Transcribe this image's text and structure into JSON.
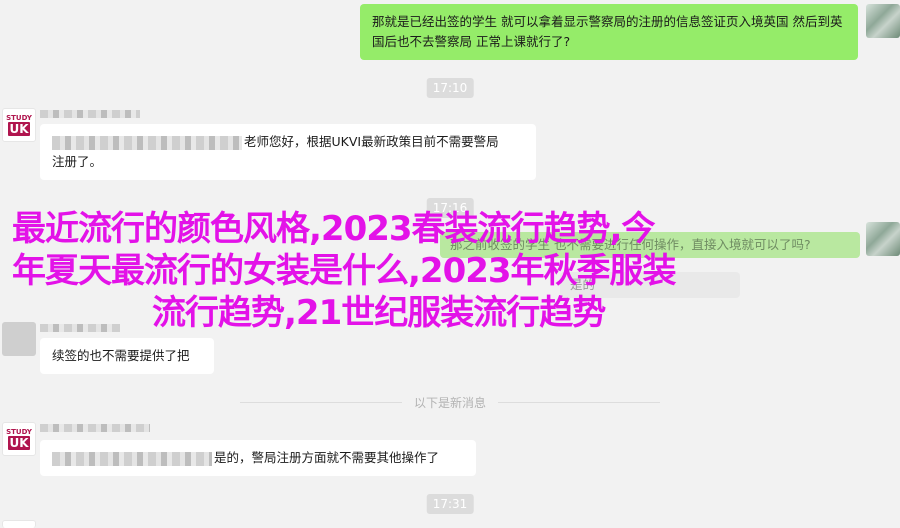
{
  "messages": {
    "m1": "那就是已经出签的学生 就可以拿着显示警察局的注册的信息签证页入境英国 然后到英国后也不去警察局 正常上课就行了?",
    "t1": "17:10",
    "m2_suffix": "老师您好，根据UKVI最新政策目前不需要警局",
    "m2_line2": "注册了。",
    "t2": "17:16",
    "m3_faint": "那之前收签的学生 也不需要进行任何操作，直接入境就可以了吗?",
    "m4_faint": "是的",
    "m5": "续签的也不需要提供了把",
    "divider": "以下是新消息",
    "m6_suffix": "是的，警局注册方面就不需要其他操作了",
    "t3": "17:31"
  },
  "avatar": {
    "brand_top": "STUDY",
    "brand_mark": "UK"
  },
  "overlay": {
    "line1": "最近流行的颜色风格,2023春装流行趋势,今",
    "line2": "年夏天最流行的女装是什么,2023年秋季服装",
    "line3": "流行趋势,21世纪服装流行趋势"
  },
  "colors": {
    "background": "#f2f2f2",
    "bubble_self": "#95ec69",
    "bubble_other": "#ffffff",
    "overlay_text": "#e312e8"
  }
}
